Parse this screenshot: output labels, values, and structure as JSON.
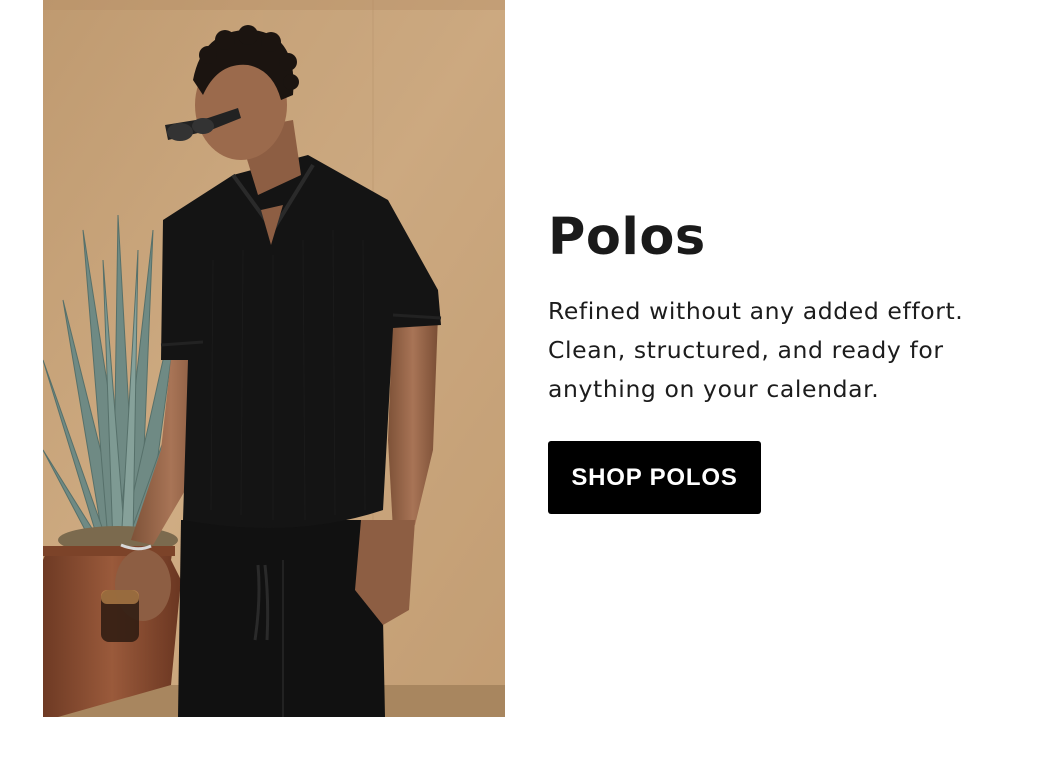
{
  "section": {
    "title": "Polos",
    "description": "Refined without any added effort. Clean, structured, and ready for anything on your calendar.",
    "cta_label": "SHOP POLOS"
  },
  "image": {
    "subject": "man-in-black-polo-photo",
    "colors": {
      "wall": "#c9a57c",
      "shirt": "#141414",
      "pot": "#8a4f33",
      "agave": "#6f8a84",
      "skin": "#9b6a4c"
    }
  },
  "colors": {
    "background": "#ffffff",
    "text": "#1a1a1a",
    "button_bg": "#000000",
    "button_text": "#ffffff"
  }
}
